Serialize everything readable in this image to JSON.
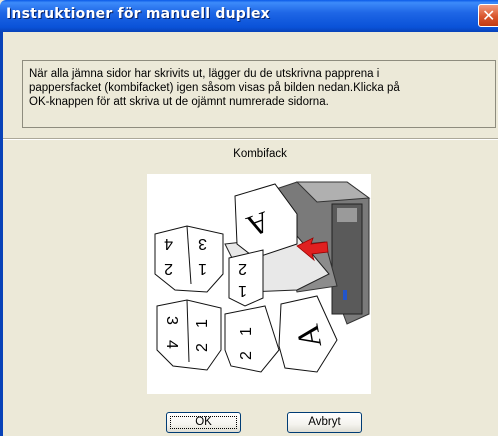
{
  "window": {
    "title": "Instruktioner för manuell duplex"
  },
  "instructions": {
    "lines": [
      "När alla jämna sidor har skrivits ut, lägger du de utskrivna papprena i",
      "pappersfacket (kombifacket) igen såsom visas på bilden nedan.Klicka på",
      "OK-knappen för att skriva ut de ojämnt numrerade sidorna."
    ]
  },
  "illustration": {
    "caption": "Kombifack",
    "stack_left_top": [
      "4",
      "3",
      "2",
      "1"
    ],
    "stack_middle_top": [
      "2",
      "1"
    ],
    "stack_left_bottom": [
      "3",
      "4",
      "1",
      "2"
    ],
    "stack_middle_bottom": [
      "1",
      "2"
    ],
    "sheet_letter": "A"
  },
  "buttons": {
    "ok": "OK",
    "cancel": "Avbryt"
  },
  "colors": {
    "titlebar": "#0A52D8",
    "dialog_bg": "#ECE9D8",
    "close_button": "#D9562E",
    "arrow": "#E02020"
  }
}
